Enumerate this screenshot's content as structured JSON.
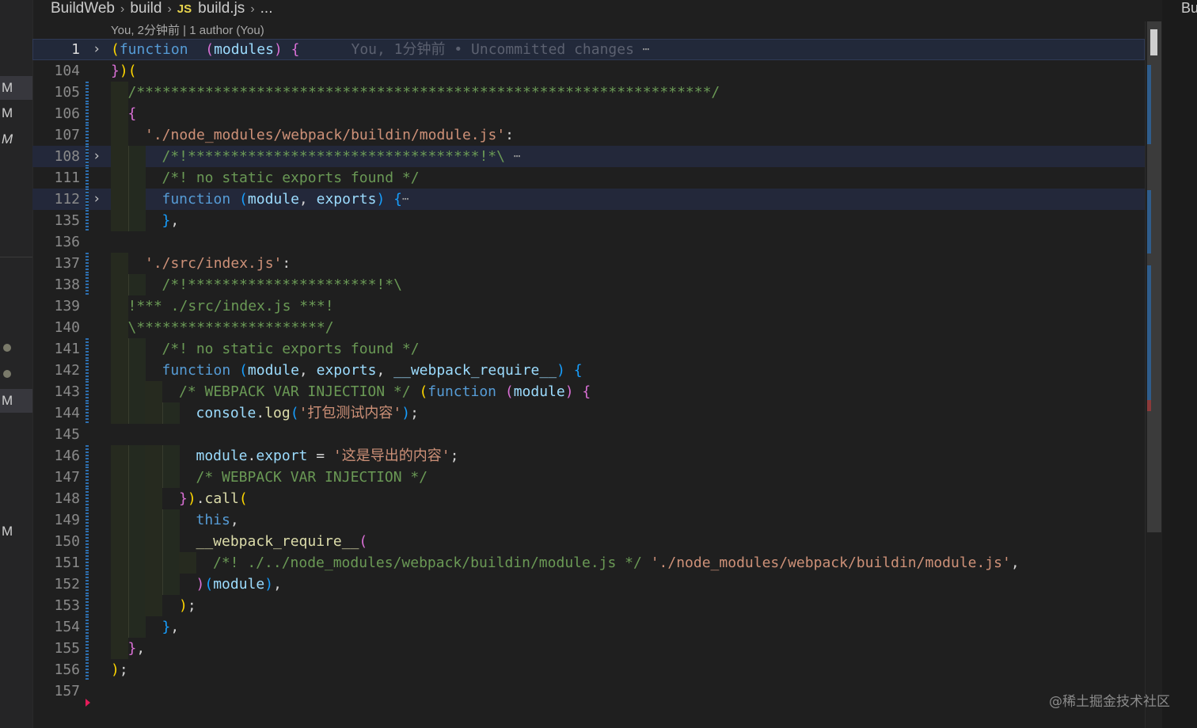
{
  "breadcrumb": {
    "root": "BuildWeb",
    "folder": "build",
    "file_badge": "JS",
    "file": "build.js",
    "more": "..."
  },
  "blame_header": "You, 2分钟前 | 1 author (You)",
  "left_strip": [
    {
      "label": "M",
      "selected": true
    },
    {
      "label": "M",
      "selected": false
    },
    {
      "label": "M",
      "selected": false
    },
    {
      "label": "M",
      "selected": true
    },
    {
      "label": "M",
      "selected": false
    }
  ],
  "right_panel": {
    "title": "Bu"
  },
  "watermark": "@稀土掘金技术社区",
  "colors": {
    "background": "#1f1f1f",
    "keyword": "#569cd6",
    "param": "#9cdcfe",
    "string": "#ce9178",
    "comment": "#6a9955",
    "bracket_gold": "#ffd700",
    "bracket_pink": "#da70d6",
    "bracket_blue": "#179fff"
  },
  "lines": [
    {
      "n": "1",
      "fold": "›",
      "tokens": [
        [
          "br1",
          "("
        ],
        [
          "kw",
          "function"
        ],
        [
          "",
          "  "
        ],
        [
          "br2",
          "("
        ],
        [
          "pm",
          "modules"
        ],
        [
          "br2",
          ")"
        ],
        [
          "",
          " "
        ],
        [
          "br2",
          "{"
        ],
        [
          "",
          "      "
        ],
        [
          "ghost",
          "You, 1分钟前 • Uncommitted changes"
        ],
        [
          "",
          " "
        ],
        [
          "dots",
          "⋯"
        ]
      ]
    },
    {
      "n": "104",
      "tokens": [
        [
          "br2",
          "}"
        ],
        [
          "br1",
          ")"
        ],
        [
          "br1",
          "("
        ]
      ]
    },
    {
      "n": "105",
      "tokens": [
        [
          "",
          ""
        ],
        [
          "cm",
          "/*******************************************************************/"
        ]
      ]
    },
    {
      "n": "106",
      "tokens": [
        [
          "br2",
          "{"
        ]
      ]
    },
    {
      "n": "107",
      "tokens": [
        [
          "str",
          "'./node_modules/webpack/buildin/module.js'"
        ],
        [
          "",
          ":"
        ]
      ]
    },
    {
      "n": "108",
      "fold": "›",
      "tokens": [
        [
          "cm",
          "/*!**********************************!*\\"
        ],
        [
          "",
          " "
        ],
        [
          "dots",
          "⋯"
        ]
      ]
    },
    {
      "n": "111",
      "tokens": [
        [
          "cm",
          "/*! no static exports found */"
        ]
      ]
    },
    {
      "n": "112",
      "fold": "›",
      "tokens": [
        [
          "kw",
          "function"
        ],
        [
          "",
          " "
        ],
        [
          "br3",
          "("
        ],
        [
          "pm",
          "module"
        ],
        [
          "",
          ", "
        ],
        [
          "pm",
          "exports"
        ],
        [
          "br3",
          ")"
        ],
        [
          "",
          " "
        ],
        [
          "br3",
          "{"
        ],
        [
          "dots",
          "⋯"
        ]
      ]
    },
    {
      "n": "135",
      "tokens": [
        [
          "br3",
          "}"
        ],
        [
          "",
          ","
        ]
      ]
    },
    {
      "n": "136",
      "tokens": []
    },
    {
      "n": "137",
      "tokens": [
        [
          "str",
          "'./src/index.js'"
        ],
        [
          "",
          ":"
        ]
      ]
    },
    {
      "n": "138",
      "tokens": [
        [
          "cm",
          "/*!**********************!*\\"
        ]
      ]
    },
    {
      "n": "139",
      "tokens": [
        [
          "cm",
          "!*** ./src/index.js ***!"
        ]
      ]
    },
    {
      "n": "140",
      "tokens": [
        [
          "cm",
          "\\**********************/"
        ]
      ]
    },
    {
      "n": "141",
      "tokens": [
        [
          "cm",
          "/*! no static exports found */"
        ]
      ]
    },
    {
      "n": "142",
      "tokens": [
        [
          "kw",
          "function"
        ],
        [
          "",
          " "
        ],
        [
          "br3",
          "("
        ],
        [
          "pm",
          "module"
        ],
        [
          "",
          ", "
        ],
        [
          "pm",
          "exports"
        ],
        [
          "",
          ", "
        ],
        [
          "pm",
          "__webpack_require__"
        ],
        [
          "br3",
          ")"
        ],
        [
          "",
          " "
        ],
        [
          "br3",
          "{"
        ]
      ]
    },
    {
      "n": "143",
      "tokens": [
        [
          "cm",
          "/* WEBPACK VAR INJECTION */"
        ],
        [
          "",
          " "
        ],
        [
          "br1",
          "("
        ],
        [
          "kw",
          "function"
        ],
        [
          "",
          " "
        ],
        [
          "br2",
          "("
        ],
        [
          "pm",
          "module"
        ],
        [
          "br2",
          ")"
        ],
        [
          "",
          " "
        ],
        [
          "br2",
          "{"
        ]
      ]
    },
    {
      "n": "144",
      "tokens": [
        [
          "pm",
          "console"
        ],
        [
          "",
          "."
        ],
        [
          "fn",
          "log"
        ],
        [
          "br3",
          "("
        ],
        [
          "str",
          "'打包测试内容'"
        ],
        [
          "br3",
          ")"
        ],
        [
          "",
          ";"
        ]
      ]
    },
    {
      "n": "145",
      "tokens": []
    },
    {
      "n": "146",
      "tokens": [
        [
          "pm",
          "module"
        ],
        [
          "",
          "."
        ],
        [
          "pm",
          "export"
        ],
        [
          "",
          " = "
        ],
        [
          "str",
          "'这是导出的内容'"
        ],
        [
          "",
          ";"
        ]
      ]
    },
    {
      "n": "147",
      "tokens": [
        [
          "cm",
          "/* WEBPACK VAR INJECTION */"
        ]
      ]
    },
    {
      "n": "148",
      "tokens": [
        [
          "br2",
          "}"
        ],
        [
          "br1",
          ")"
        ],
        [
          "",
          "."
        ],
        [
          "fn",
          "call"
        ],
        [
          "br1",
          "("
        ]
      ]
    },
    {
      "n": "149",
      "tokens": [
        [
          "kw",
          "this"
        ],
        [
          "",
          ","
        ]
      ]
    },
    {
      "n": "150",
      "tokens": [
        [
          "fn",
          "__webpack_require__"
        ],
        [
          "br2",
          "("
        ]
      ]
    },
    {
      "n": "151",
      "tokens": [
        [
          "cm",
          "/*! ./../node_modules/webpack/buildin/module.js */"
        ],
        [
          "",
          " "
        ],
        [
          "str",
          "'./node_modules/webpack/buildin/module.js'"
        ],
        [
          "",
          ","
        ]
      ]
    },
    {
      "n": "152",
      "tokens": [
        [
          "br2",
          ")"
        ],
        [
          "br3",
          "("
        ],
        [
          "pm",
          "module"
        ],
        [
          "br3",
          ")"
        ],
        [
          "",
          ","
        ]
      ]
    },
    {
      "n": "153",
      "tokens": [
        [
          "br1",
          ")"
        ],
        [
          "",
          ";"
        ]
      ]
    },
    {
      "n": "154",
      "tokens": [
        [
          "br3",
          "}"
        ],
        [
          "",
          ","
        ]
      ]
    },
    {
      "n": "155",
      "tokens": [
        [
          "br2",
          "}"
        ],
        [
          "",
          ","
        ]
      ]
    },
    {
      "n": "156",
      "tokens": [
        [
          "br1",
          ")"
        ],
        [
          "",
          ";"
        ]
      ]
    },
    {
      "n": "157",
      "tokens": []
    }
  ]
}
